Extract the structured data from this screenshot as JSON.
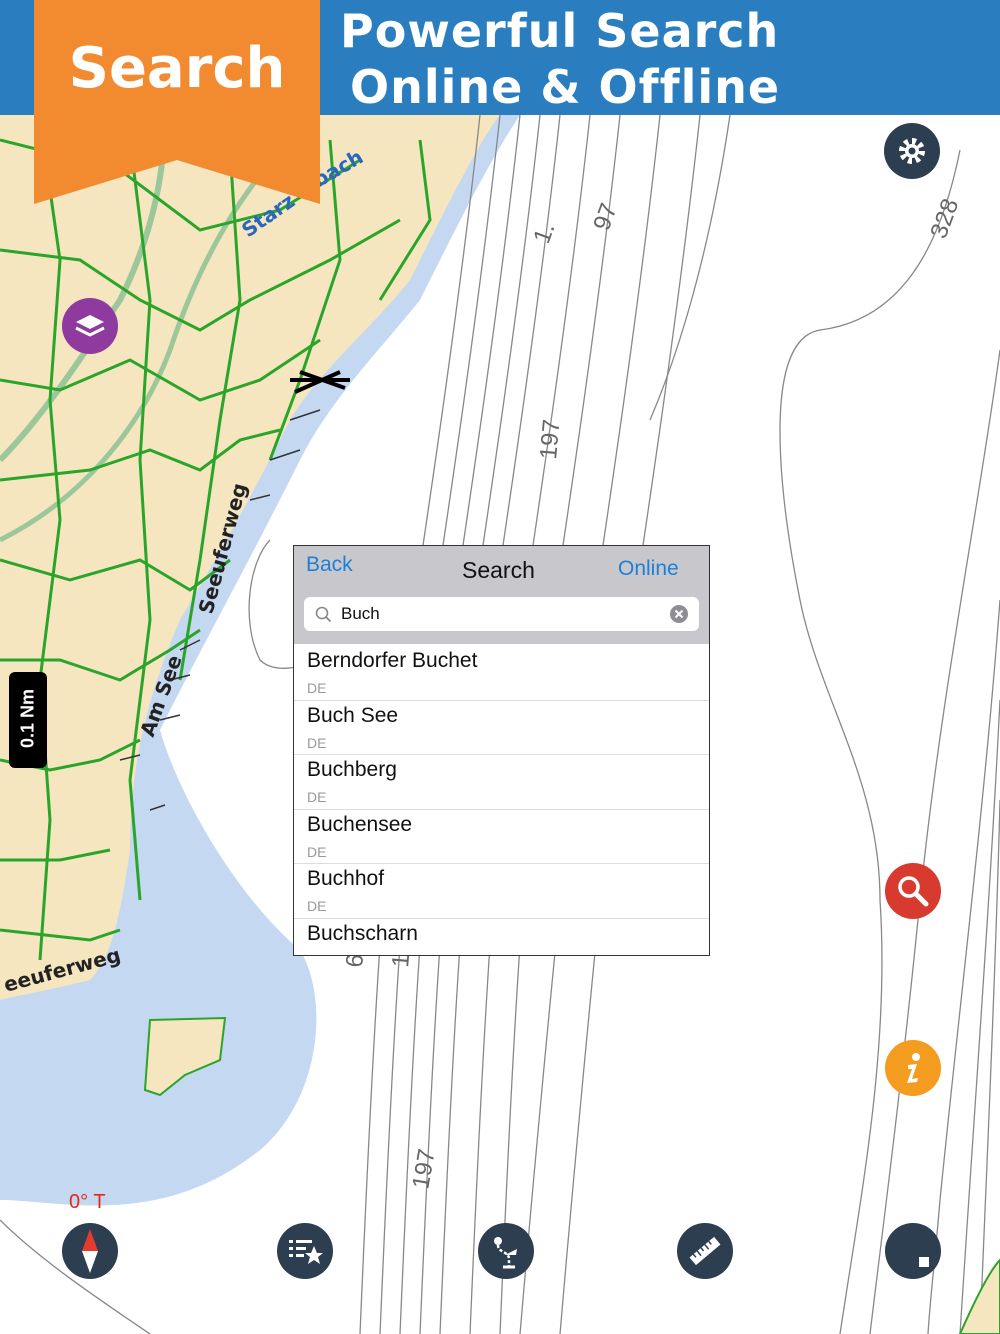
{
  "header": {
    "line1": "Powerful Search",
    "line2": "Online & Offline"
  },
  "banner": {
    "label": "Search"
  },
  "map": {
    "depth_labels": [
      "1.",
      "97",
      "328",
      "197",
      "197",
      "6",
      "1",
      "197"
    ],
    "street_labels": [
      "Seeuferweg",
      "Am See",
      "eeuferweg",
      "Starz",
      "bach"
    ],
    "scale": "0.1 Nm",
    "heading": "0° T"
  },
  "search_panel": {
    "back": "Back",
    "title": "Search",
    "online": "Online",
    "query": "Buch",
    "results": [
      {
        "name": "Berndorfer Buchet",
        "country": "DE"
      },
      {
        "name": "Buch See",
        "country": "DE"
      },
      {
        "name": "Buchberg",
        "country": "DE"
      },
      {
        "name": "Buchensee",
        "country": "DE"
      },
      {
        "name": "Buchhof",
        "country": "DE"
      },
      {
        "name": "Buchscharn",
        "country": ""
      }
    ]
  },
  "buttons": {
    "settings": "gear-icon",
    "layers": "layers-icon",
    "search": "search-icon",
    "info": "info-icon",
    "compass": "compass-icon",
    "favorites": "favorites-list-icon",
    "route": "route-icon",
    "measure": "ruler-icon",
    "track": "stop-icon"
  },
  "colors": {
    "header": "#2a7ec0",
    "banner": "#f28a30",
    "land": "#f5e6c0",
    "water": "#c4d8f2",
    "roads": "#2aa52a"
  }
}
